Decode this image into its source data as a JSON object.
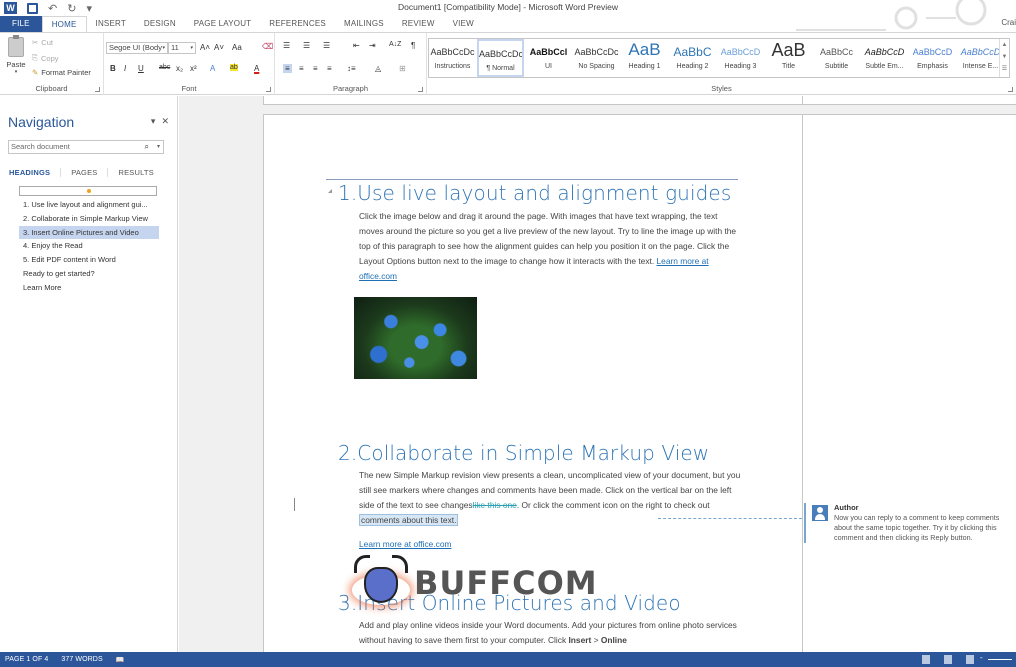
{
  "window": {
    "title": "Document1 [Compatibility Mode] - Microsoft Word Preview",
    "user": "Crai"
  },
  "qat": {
    "undo": "↶",
    "redo": "↻",
    "more": "▾"
  },
  "tabs": [
    {
      "label": "FILE"
    },
    {
      "label": "HOME"
    },
    {
      "label": "INSERT"
    },
    {
      "label": "DESIGN"
    },
    {
      "label": "PAGE LAYOUT"
    },
    {
      "label": "REFERENCES"
    },
    {
      "label": "MAILINGS"
    },
    {
      "label": "REVIEW"
    },
    {
      "label": "VIEW"
    }
  ],
  "ribbon": {
    "clipboard": {
      "label": "Clipboard",
      "paste": "Paste",
      "cut": "Cut",
      "copy": "Copy",
      "format_painter": "Format Painter"
    },
    "font": {
      "label": "Font",
      "font_name": "Segoe UI (Body",
      "font_size": "11",
      "grow": "A˄",
      "shrink": "A˅",
      "change_case": "Aa",
      "bold": "B",
      "italic": "I",
      "underline": "U",
      "strikethrough": "abc",
      "subscript": "x₂",
      "superscript": "x²",
      "text_effects": "A",
      "highlight": "ab",
      "font_color": "A"
    },
    "paragraph": {
      "label": "Paragraph",
      "sort": "A↓Z",
      "show_marks": "¶"
    },
    "styles": {
      "label": "Styles",
      "items": [
        {
          "preview": "AaBbCcDc",
          "name": "Instructions"
        },
        {
          "preview": "AaBbCcDc",
          "name": "¶ Normal",
          "selected": true
        },
        {
          "preview": "AaBbCcl",
          "name": "UI"
        },
        {
          "preview": "AaBbCcDc",
          "name": "No Spacing"
        },
        {
          "preview": "AaB",
          "name": "Heading 1"
        },
        {
          "preview": "AaBbC",
          "name": "Heading 2"
        },
        {
          "preview": "AaBbCcD",
          "name": "Heading 3"
        },
        {
          "preview": "AaB",
          "name": "Title"
        },
        {
          "preview": "AaBbCc",
          "name": "Subtitle"
        },
        {
          "preview": "AaBbCcD",
          "name": "Subtle Em..."
        },
        {
          "preview": "AaBbCcD",
          "name": "Emphasis"
        },
        {
          "preview": "AaBbCcD",
          "name": "Intense E..."
        }
      ]
    }
  },
  "navigation": {
    "title": "Navigation",
    "search_placeholder": "Search document",
    "tabs": [
      {
        "label": "HEADINGS",
        "active": true
      },
      {
        "label": "PAGES"
      },
      {
        "label": "RESULTS"
      }
    ],
    "items": [
      {
        "label": "1. Use live layout and alignment gui..."
      },
      {
        "label": "2. Collaborate in Simple Markup View"
      },
      {
        "label": "3. Insert Online Pictures and Video",
        "selected": true
      },
      {
        "label": "4. Enjoy the Read"
      },
      {
        "label": "5. Edit PDF content in Word"
      },
      {
        "label": "Ready to get started?"
      },
      {
        "label": "Learn More"
      }
    ]
  },
  "document": {
    "section1": {
      "number": "1.",
      "heading": "Use live layout and alignment guides",
      "body": "Click the image below and drag it around the page. With images that have text wrapping, the text moves around the picture so you get a live preview of the new layout. Try to line the image up with the top of this paragraph to see how the alignment guides can help you position it on the page.  Click the Layout Options button next to the image to change how it interacts with the text. ",
      "link": "Learn more at office.com"
    },
    "section2": {
      "number": "2.",
      "heading": "Collaborate in Simple Markup View",
      "body_part1": "The new Simple Markup revision view presents a clean, uncomplicated view of your document, but you still see markers where changes and comments have been made. Click on the vertical bar on the left side of the text to see changes",
      "deleted_text": "like this one",
      "body_part2": ". Or click the comment icon on the right to check out ",
      "commented_text": "comments about this text.",
      "link": "Learn more at office.com"
    },
    "section3": {
      "number": "3.",
      "heading": "Insert Online Pictures and Video",
      "body_part1": "Add and play online videos inside your Word documents. Add your pictures from online photo services without having to save them first to your computer. Click ",
      "bold1": "Insert",
      "sep": " > ",
      "bold2": "Online"
    },
    "comment": {
      "author": "Author",
      "text": "Now you can reply to a comment to keep comments about the same topic together. Try it by clicking this comment and then clicking its Reply button."
    },
    "watermark": "BUFFCOM"
  },
  "statusbar": {
    "page": "PAGE 1 OF 4",
    "words": "377 WORDS"
  }
}
